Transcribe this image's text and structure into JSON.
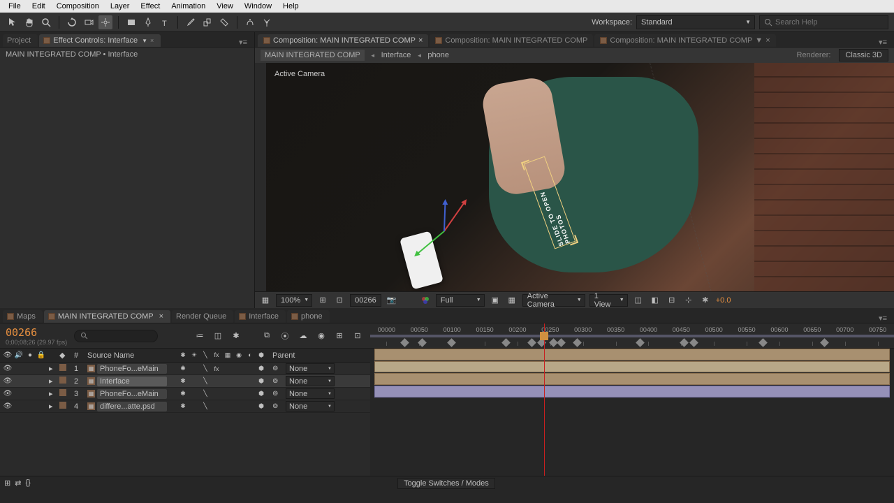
{
  "menu": [
    "File",
    "Edit",
    "Composition",
    "Layer",
    "Effect",
    "Animation",
    "View",
    "Window",
    "Help"
  ],
  "toolbar": {
    "workspace_label": "Workspace:",
    "workspace_value": "Standard",
    "search_placeholder": "Search Help"
  },
  "left_panel": {
    "tabs": [
      {
        "label": "Project"
      },
      {
        "label": "Effect Controls: Interface"
      }
    ],
    "breadcrumb": "MAIN INTEGRATED COMP • Interface"
  },
  "comp_panel": {
    "tabs": [
      {
        "label": "Composition: MAIN INTEGRATED COMP"
      },
      {
        "label": "Composition: MAIN INTEGRATED COMP"
      },
      {
        "label": "Composition: MAIN INTEGRATED COMP"
      }
    ],
    "breadcrumb": [
      "MAIN INTEGRATED COMP",
      "Interface",
      "phone"
    ],
    "renderer_label": "Renderer:",
    "renderer_value": "Classic 3D",
    "viewport_label": "Active Camera",
    "slide_text": "SLIDE TO OPEN PHOTOS"
  },
  "viewport_controls": {
    "zoom": "100%",
    "frame": "00266",
    "resolution": "Full",
    "camera": "Active Camera",
    "views": "1 View",
    "exposure": "+0.0"
  },
  "timeline": {
    "tabs": [
      "Maps",
      "MAIN INTEGRATED COMP",
      "Render Queue",
      "Interface",
      "phone"
    ],
    "active_tab": 1,
    "timecode": "00266",
    "timecode_sub": "0;00;08;26 (29.97 fps)",
    "columns": {
      "source_name": "Source Name",
      "parent": "Parent"
    },
    "layers": [
      {
        "num": 1,
        "name": "PhoneFo...eMain",
        "parent": "None",
        "icon": "comp"
      },
      {
        "num": 2,
        "name": "Interface",
        "parent": "None",
        "icon": "comp",
        "selected": true
      },
      {
        "num": 3,
        "name": "PhoneFo...eMain",
        "parent": "None",
        "icon": "comp"
      },
      {
        "num": 4,
        "name": "differe...atte.psd",
        "parent": "None",
        "icon": "psd"
      }
    ],
    "time_marks": [
      "00000",
      "00050",
      "00100",
      "00150",
      "00200",
      "00250",
      "00300",
      "00350",
      "00400",
      "00450",
      "00500",
      "00550",
      "00600",
      "00650",
      "00700",
      "00750"
    ],
    "toggle_label": "Toggle Switches / Modes"
  }
}
